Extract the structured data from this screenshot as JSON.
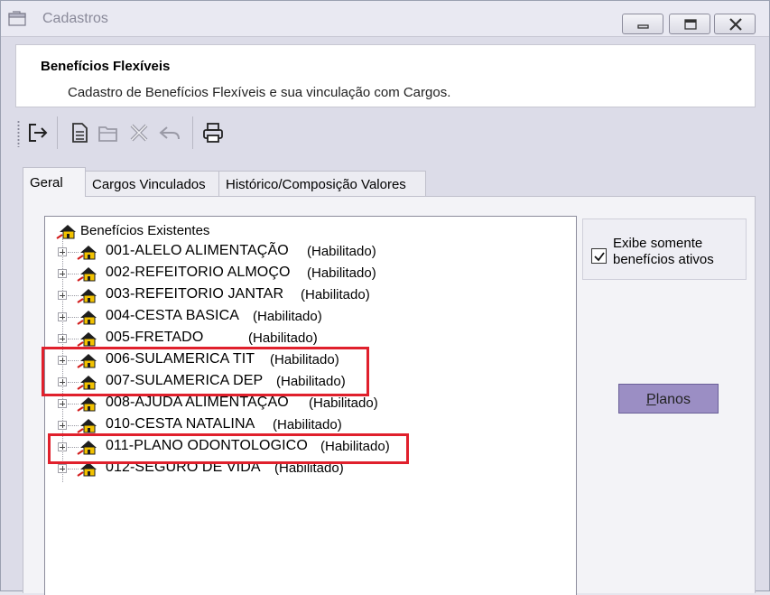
{
  "window": {
    "title": "Cadastros",
    "controls": [
      "minimize",
      "restore",
      "close"
    ]
  },
  "header": {
    "title": "Benefícios Flexíveis",
    "description": "Cadastro de Benefícios Flexíveis e sua vinculação com Cargos."
  },
  "toolbar": {
    "buttons": [
      {
        "icon": "exit-icon",
        "enabled": true
      },
      {
        "icon": "new-document-icon",
        "enabled": true
      },
      {
        "icon": "open-folder-icon",
        "enabled": false
      },
      {
        "icon": "delete-icon",
        "enabled": false
      },
      {
        "icon": "undo-icon",
        "enabled": false
      },
      {
        "icon": "print-icon",
        "enabled": true
      }
    ]
  },
  "tabs": [
    {
      "label": "Geral",
      "active": true
    },
    {
      "label": "Cargos Vinculados",
      "active": false
    },
    {
      "label": "Histórico/Composição Valores",
      "active": false
    }
  ],
  "tree": {
    "root_label": "Benefícios Existentes",
    "items": [
      {
        "code": "001-ALELO ALIMENTAÇÃO",
        "status": "(Habilitado)"
      },
      {
        "code": "002-REFEITORIO ALMOÇO",
        "status": "(Habilitado)"
      },
      {
        "code": "003-REFEITORIO JANTAR",
        "status": "(Habilitado)"
      },
      {
        "code": "004-CESTA BASICA",
        "status": "(Habilitado)"
      },
      {
        "code": "005-FRETADO",
        "status": "(Habilitado)"
      },
      {
        "code": "006-SULAMERICA TIT",
        "status": "(Habilitado)"
      },
      {
        "code": "007-SULAMERICA DEP",
        "status": "(Habilitado)"
      },
      {
        "code": "008-AJUDA ALIMENTAÇÃO",
        "status": "(Habilitado)"
      },
      {
        "code": "010-CESTA NATALINA",
        "status": "(Habilitado)"
      },
      {
        "code": "011-PLANO ODONTOLOGICO",
        "status": "(Habilitado)"
      },
      {
        "code": "012-SEGURO DE VIDA",
        "status": "(Habilitado)"
      }
    ]
  },
  "options": {
    "active_only_label_line1": "Exibe somente",
    "active_only_label_line2": "benefícios ativos",
    "active_only_checked": true
  },
  "planos_button": {
    "accel": "P",
    "rest": "lanos"
  },
  "colors": {
    "highlight": "#e0202c",
    "planos_button": "#9b8ec4",
    "benefit_icon": "#f2c200"
  }
}
